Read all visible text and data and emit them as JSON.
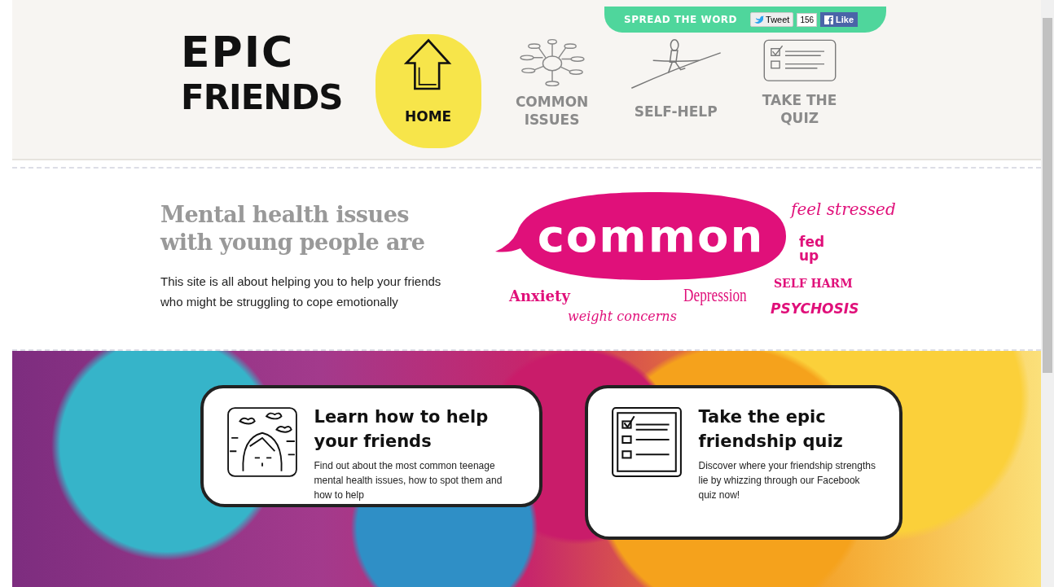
{
  "share_bar": {
    "label": "SPREAD THE WORD",
    "tweet_button": "Tweet",
    "tweet_count": "156",
    "like_button": "Like"
  },
  "logo": {
    "line_1": "EPIC",
    "line_2": "FRIENDS"
  },
  "nav": [
    {
      "kind": "house",
      "label": "HOME",
      "selected": true
    },
    {
      "kind": "mindmap",
      "label": "COMMON ISSUES",
      "selected": false
    },
    {
      "kind": "tightrope",
      "label": "SELF-HELP",
      "selected": false
    },
    {
      "kind": "checklist",
      "label": "TAKE THE QUIZ",
      "selected": false
    }
  ],
  "intro": {
    "heading_line_1": "Mental health issues",
    "heading_line_2": "with young people are",
    "text": "This site is all about helping you to help your friends who might be struggling to cope emotionally"
  },
  "word_cloud": {
    "bubble": "common",
    "words": [
      "feel stressed",
      "fed up",
      "SELF HARM",
      "Anxiety",
      "Depression",
      "PSYCHOSIS",
      "weight concerns"
    ]
  },
  "cards": [
    {
      "kind": "face",
      "title": "Learn how to help your friends",
      "text": "Find out about the most common teenage mental health issues, how to spot them and how to help"
    },
    {
      "kind": "checklist",
      "title": "Take the epic friendship quiz",
      "text": "Discover where your friendship strengths lie by whizzing through our Facebook quiz now!"
    }
  ]
}
